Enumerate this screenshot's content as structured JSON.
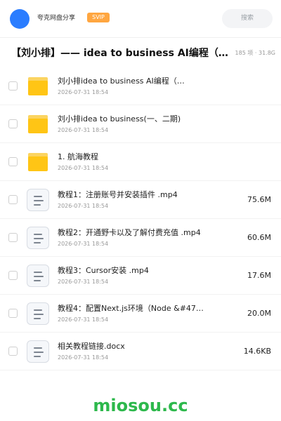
{
  "header": {
    "user_name": "夸克网盘分享",
    "badge": "SVIP",
    "search_placeholder": "搜索"
  },
  "folder": {
    "title": "【刘小排】—— idea to business AI编程（1…",
    "meta": "185 项 · 31.8G"
  },
  "items": [
    {
      "type": "folder",
      "name": "刘小排idea to business AI编程（…",
      "date": "2026-07-31 18:54",
      "size": ""
    },
    {
      "type": "folder",
      "name": "刘小排idea to business(一、二期)",
      "date": "2026-07-31 18:54",
      "size": ""
    },
    {
      "type": "folder",
      "name": "1. 航海教程",
      "date": "2026-07-31 18:54",
      "size": ""
    },
    {
      "type": "file",
      "name": "教程1：注册账号并安装插件 .mp4",
      "date": "2026-07-31 18:54",
      "size": "75.6M"
    },
    {
      "type": "file",
      "name": "教程2：开通野卡以及了解付费充值 .mp4",
      "date": "2026-07-31 18:54",
      "size": "60.6M"
    },
    {
      "type": "file",
      "name": "教程3：Cursor安装 .mp4",
      "date": "2026-07-31 18:54",
      "size": "17.6M"
    },
    {
      "type": "file",
      "name": "教程4：配置Next.js环境（Node &#47…",
      "date": "2026-07-31 18:54",
      "size": "20.0M"
    },
    {
      "type": "file",
      "name": "相关教程链接.docx",
      "date": "2026-07-31 18:54",
      "size": "14.6KB"
    }
  ],
  "watermark": "miosou.cc",
  "colors": {
    "accent": "#2b7dff",
    "svip": "#ffa640",
    "folder": "#ffc515",
    "watermark": "#2db84c"
  }
}
